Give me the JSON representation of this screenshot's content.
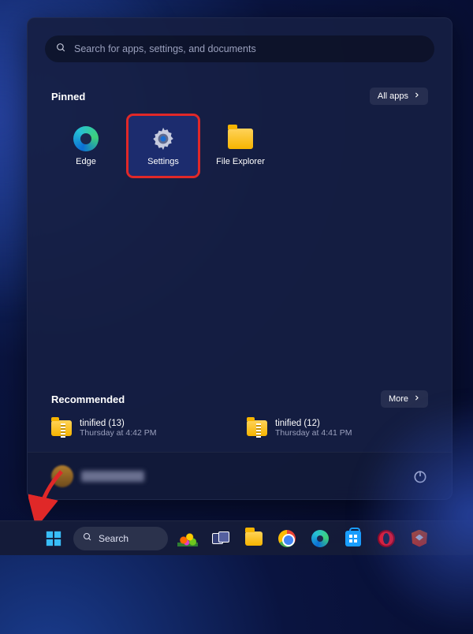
{
  "search": {
    "placeholder": "Search for apps, settings, and documents"
  },
  "sections": {
    "pinned": {
      "title": "Pinned",
      "button": "All apps"
    },
    "recommended": {
      "title": "Recommended",
      "button": "More"
    }
  },
  "pinned_apps": [
    {
      "id": "edge",
      "label": "Edge",
      "icon": "edge-icon",
      "highlighted": false
    },
    {
      "id": "settings",
      "label": "Settings",
      "icon": "gear-icon",
      "highlighted": true
    },
    {
      "id": "file-explorer",
      "label": "File Explorer",
      "icon": "folder-icon",
      "highlighted": false
    }
  ],
  "recommended_items": [
    {
      "name": "tinified (13)",
      "time": "Thursday at 4:42 PM",
      "icon": "zip-folder-icon"
    },
    {
      "name": "tinified (12)",
      "time": "Thursday at 4:41 PM",
      "icon": "zip-folder-icon"
    }
  ],
  "footer": {
    "power_icon": "power-icon"
  },
  "taskbar": {
    "search_label": "Search",
    "items": [
      {
        "id": "start",
        "icon": "windows-icon"
      },
      {
        "id": "search",
        "icon": "search-icon"
      },
      {
        "id": "widgets",
        "icon": "widgets-icon"
      },
      {
        "id": "taskview",
        "icon": "taskview-icon"
      },
      {
        "id": "file-explorer",
        "icon": "folder-icon"
      },
      {
        "id": "chrome",
        "icon": "chrome-icon"
      },
      {
        "id": "edge",
        "icon": "edge-icon"
      },
      {
        "id": "store",
        "icon": "store-icon"
      },
      {
        "id": "opera",
        "icon": "opera-icon"
      },
      {
        "id": "brave",
        "icon": "brave-icon"
      }
    ]
  },
  "annotation": {
    "highlight_target": "settings",
    "arrow_target": "start"
  }
}
